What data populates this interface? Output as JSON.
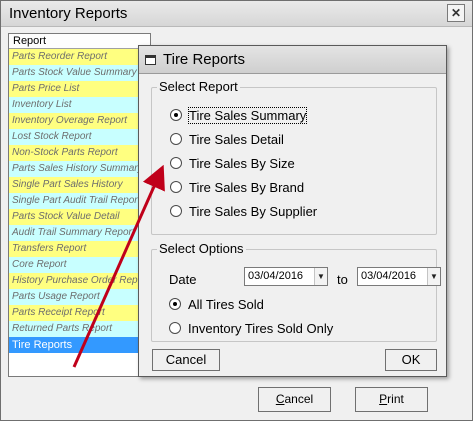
{
  "window": {
    "title": "Inventory Reports",
    "close_glyph": "✕"
  },
  "list": {
    "header": "Report",
    "items": [
      {
        "label": "Parts Reorder Report",
        "color": "yellow"
      },
      {
        "label": "Parts Stock Value Summary",
        "color": "cyan"
      },
      {
        "label": "Parts Price List",
        "color": "yellow"
      },
      {
        "label": "Inventory List",
        "color": "cyan"
      },
      {
        "label": "Inventory Overage Report",
        "color": "yellow"
      },
      {
        "label": "Lost Stock Report",
        "color": "cyan"
      },
      {
        "label": "Non-Stock Parts Report",
        "color": "yellow"
      },
      {
        "label": "Parts Sales History Summary",
        "color": "cyan"
      },
      {
        "label": "Single Part Sales History",
        "color": "yellow"
      },
      {
        "label": "Single Part Audit Trail Report",
        "color": "cyan"
      },
      {
        "label": "Parts Stock Value Detail",
        "color": "yellow"
      },
      {
        "label": "Audit Trail Summary Report",
        "color": "cyan"
      },
      {
        "label": "Transfers Report",
        "color": "yellow"
      },
      {
        "label": "Core Report",
        "color": "cyan"
      },
      {
        "label": "History Purchase Order Report",
        "color": "yellow"
      },
      {
        "label": "Parts Usage Report",
        "color": "cyan"
      },
      {
        "label": "Parts Receipt Report",
        "color": "yellow"
      },
      {
        "label": "Returned Parts Report",
        "color": "cyan"
      },
      {
        "label": "Tire Reports",
        "color": "selected"
      }
    ]
  },
  "buttons": {
    "cancel": "Cancel",
    "print": "Print"
  },
  "dialog": {
    "title": "Tire Reports",
    "select_report": {
      "label": "Select Report",
      "options": [
        {
          "label": "Tire Sales Summary",
          "checked": true
        },
        {
          "label": "Tire Sales Detail",
          "checked": false
        },
        {
          "label": "Tire Sales By Size",
          "checked": false
        },
        {
          "label": "Tire Sales By Brand",
          "checked": false
        },
        {
          "label": "Tire Sales By Supplier",
          "checked": false
        }
      ]
    },
    "select_options": {
      "label": "Select Options",
      "date_label": "Date",
      "date_from": "03/04/2016",
      "to_label": "to",
      "date_to": "03/04/2016",
      "options": [
        {
          "label": "All Tires Sold",
          "checked": true
        },
        {
          "label": "Inventory Tires Sold Only",
          "checked": false
        }
      ]
    },
    "cancel": "Cancel",
    "ok": "OK"
  },
  "colors": {
    "yellow": "#ffff80",
    "cyan": "#c8ffff",
    "selected": "#3399ff",
    "arrow": "#c0001a"
  }
}
